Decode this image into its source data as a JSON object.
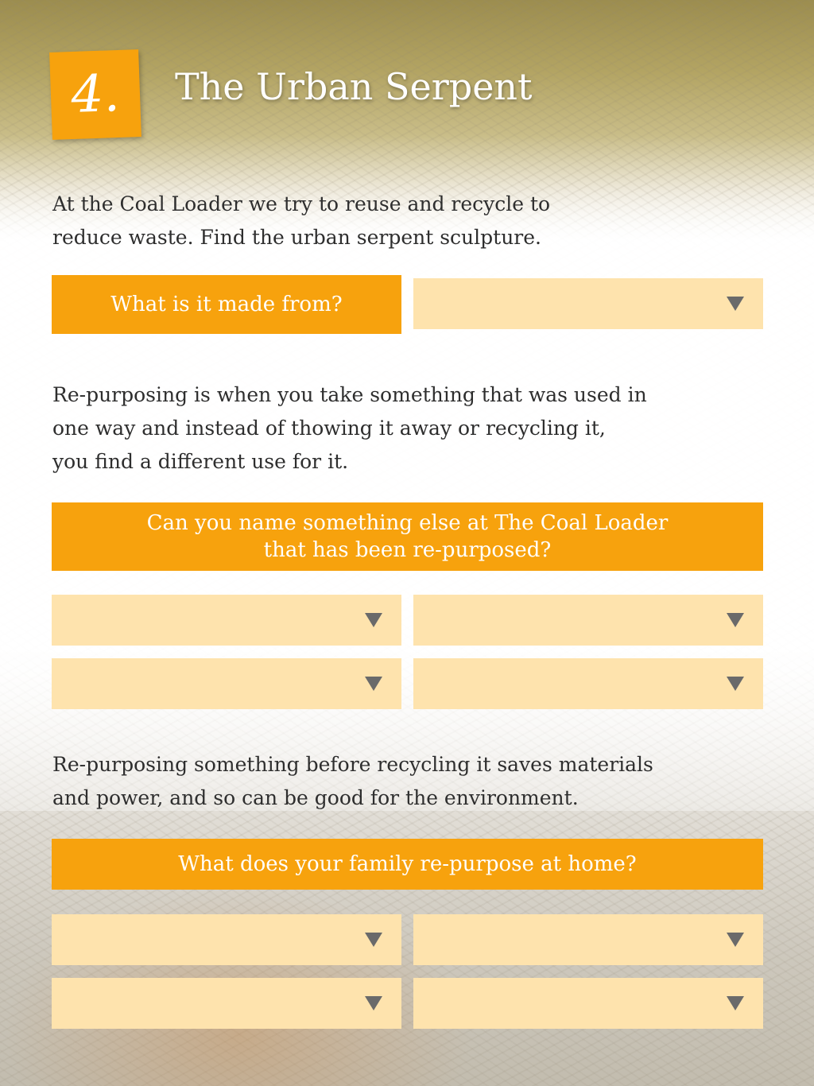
{
  "header": {
    "number": "4.",
    "title": "The Urban Serpent"
  },
  "intro": {
    "lines": [
      "At the Coal Loader we try to reuse and recycle to",
      "reduce waste. Find the urban serpent sculpture."
    ]
  },
  "question1": {
    "label": "What is it made from?",
    "selected_value": ""
  },
  "repurpose_info": {
    "lines": [
      "Re-purposing is when you take something that was used in",
      "one way and instead of thowing it away or recycling it,",
      "you find a different use for it."
    ]
  },
  "question2": {
    "lines": [
      "Can you name something else at The Coal Loader",
      "that has been re-purposed?"
    ],
    "answers": [
      "",
      "",
      "",
      ""
    ]
  },
  "environment_info": {
    "lines": [
      "Re-purposing something before recycling it saves materials",
      "and power, and so can be good for the environment."
    ]
  },
  "question3": {
    "label": "What does your family re-purpose at home?",
    "answers": [
      "",
      "",
      "",
      ""
    ]
  },
  "colors": {
    "accent": "#f7a20d",
    "dropdown_bg": "#fee3ad",
    "arrow": "#6a6a6a"
  },
  "icons": {
    "dropdown_arrow": "triangle-down"
  }
}
